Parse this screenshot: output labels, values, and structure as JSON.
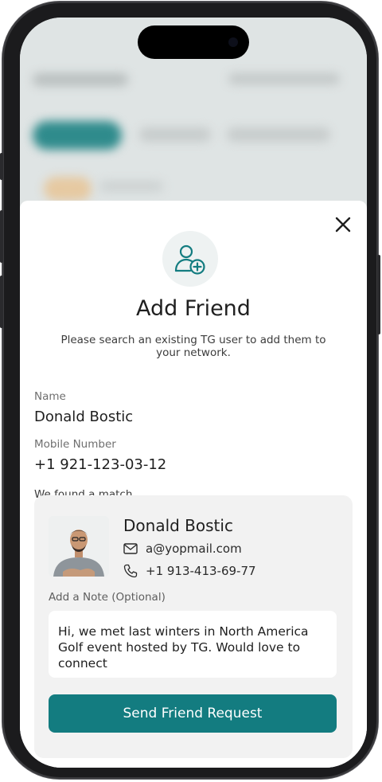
{
  "sheet": {
    "title": "Add Friend",
    "subtitle": "Please search an existing TG user to add them to your network.",
    "close_icon": "close-icon",
    "header_icon": "add-user-icon"
  },
  "fields": {
    "name_label": "Name",
    "name_value": "Donald Bostic",
    "mobile_label": "Mobile Number",
    "mobile_value": "+1 921-123-03-12"
  },
  "match": {
    "heading": "We found a match",
    "name": "Donald Bostic",
    "email": "a@yopmail.com",
    "phone": "+1 913-413-69-77",
    "note_label": "Add a Note (Optional)",
    "note_value": "Hi,  we met last winters in North America Golf event hosted by TG. Would love to connect",
    "send_label": "Send Friend Request"
  },
  "colors": {
    "accent": "#137c80",
    "card_bg": "#f2f2f2"
  }
}
